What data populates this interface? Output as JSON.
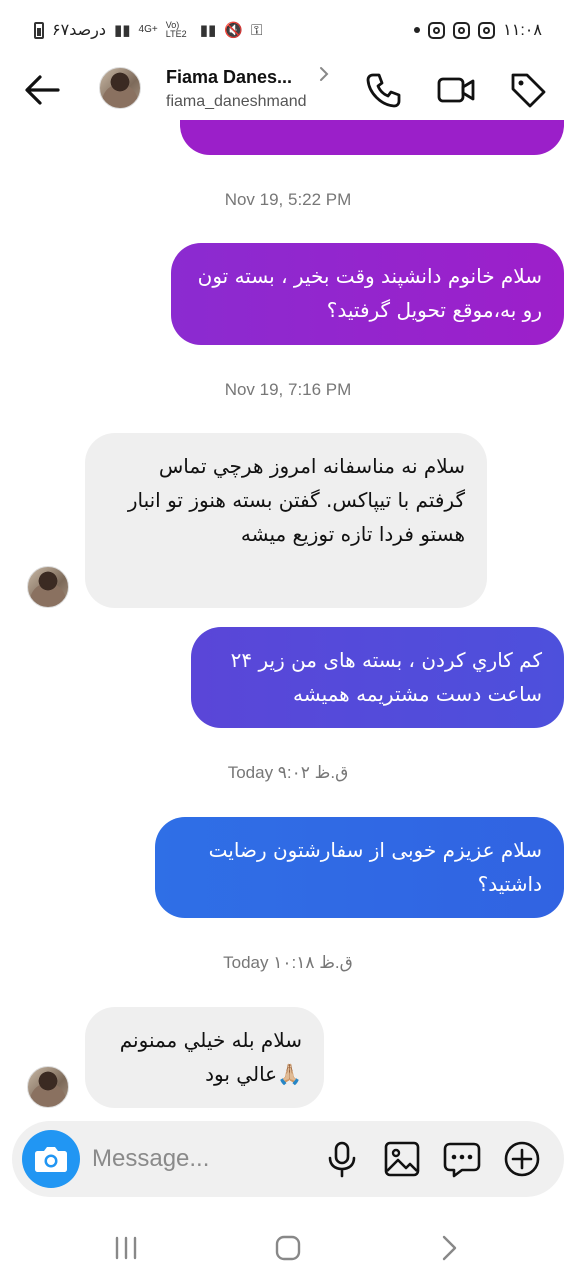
{
  "status_bar": {
    "time": "۱۱:۰۸",
    "battery_text": "۶۷درصد",
    "network_label": "4G+",
    "volte_label": "Vo) LTE2"
  },
  "header": {
    "name": "Fiama Danes...",
    "username": "fiama_daneshmand"
  },
  "messages": [
    {
      "type": "outgoing",
      "text": "سلام خانوم دانشپند وقت بخير ، بسته تون رو به،موقع تحويل گرفتيد؟"
    },
    {
      "type": "incoming",
      "text": "سلام نه مناسفانه امروز هرچي تماس گرفتم با تيپاكس. گفتن بسته هنوز تو انبار هستو فردا تازه توزيع ميشه"
    },
    {
      "type": "outgoing",
      "text": "كم كاري كردن ، بسته هاى من زير ٢۴ ساعت دست مشتريمه هميشه"
    },
    {
      "type": "outgoing",
      "text": "سلام عزيزم خوبى از سفارشتون رضايت داشتيد؟"
    },
    {
      "type": "incoming",
      "text": "سلام بله خيلي ممنونم 🙏🏼عالي بود"
    }
  ],
  "timestamps": [
    "Nov 19, 5:22 PM",
    "Nov 19, 7:16 PM",
    "Today ق.ظ ۹:۰۲",
    "Today ق.ظ ۱۰:۱۸"
  ],
  "composer": {
    "placeholder": "Message..."
  },
  "colors": {
    "bubble_purple": "#9b1fc9",
    "bubble_violet": "#5348d6",
    "bubble_blue": "#2f6fe6",
    "incoming_bg": "#efefef",
    "camera_blue": "#2196f3"
  },
  "icons": [
    "back-arrow-icon",
    "chevron-right-icon",
    "phone-icon",
    "video-camera-icon",
    "tag-icon",
    "camera-icon",
    "microphone-icon",
    "gallery-icon",
    "sticker-icon",
    "plus-icon",
    "recent-apps-icon",
    "home-icon",
    "nav-back-icon"
  ]
}
